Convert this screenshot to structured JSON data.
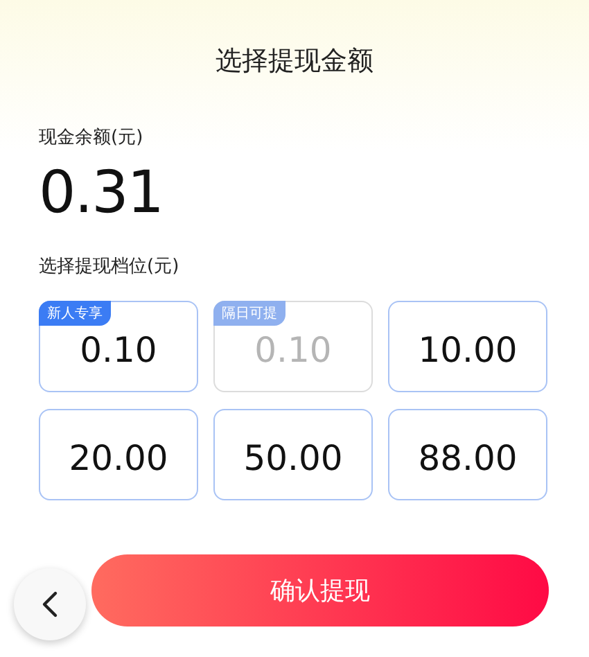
{
  "title": "选择提现金额",
  "balance": {
    "label": "现金余额(元)",
    "amount": "0.31"
  },
  "options_label": "选择提现档位(元)",
  "options": [
    {
      "amount": "0.10",
      "tag": "新人专享",
      "disabled": false
    },
    {
      "amount": "0.10",
      "tag": "隔日可提",
      "disabled": true
    },
    {
      "amount": "10.00",
      "disabled": false
    },
    {
      "amount": "20.00",
      "disabled": false
    },
    {
      "amount": "50.00",
      "disabled": false
    },
    {
      "amount": "88.00",
      "disabled": false
    }
  ],
  "confirm_button": "确认提现"
}
